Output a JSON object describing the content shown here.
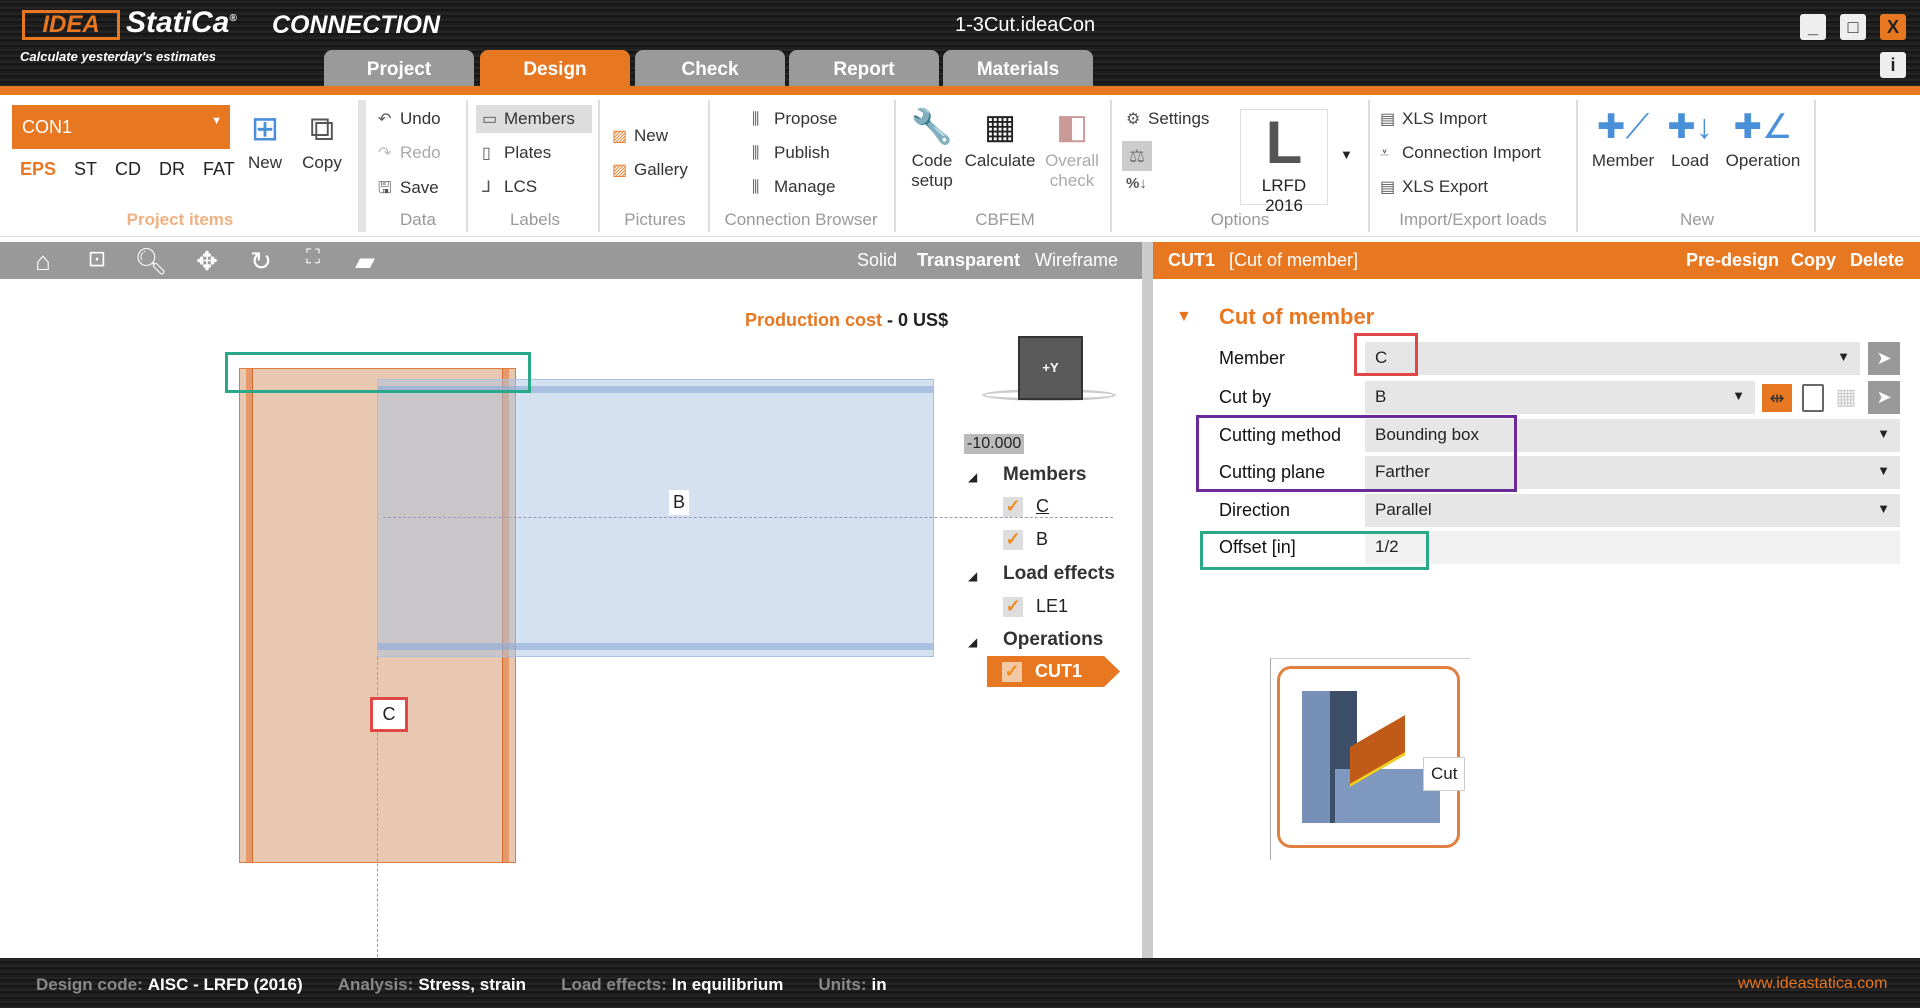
{
  "app": {
    "logo": "IDEA StatiCa",
    "product": "CONNECTION",
    "slogan": "Calculate yesterday's estimates",
    "file_title": "1-3Cut.ideaCon",
    "minimize": "_",
    "maximize": "□",
    "close": "X",
    "info": "i"
  },
  "tabs": [
    {
      "label": "Project"
    },
    {
      "label": "Design",
      "active": true
    },
    {
      "label": "Check"
    },
    {
      "label": "Report"
    },
    {
      "label": "Materials"
    }
  ],
  "ribbon": {
    "project_items": {
      "selected": "CON1",
      "codes": [
        "EPS",
        "ST",
        "CD",
        "DR",
        "FAT"
      ],
      "new": "New",
      "copy": "Copy",
      "label": "Project items"
    },
    "data": {
      "undo": "Undo",
      "redo": "Redo",
      "save": "Save",
      "label": "Data"
    },
    "labels": {
      "members": "Members",
      "plates": "Plates",
      "lcs": "LCS",
      "label": "Labels"
    },
    "pictures": {
      "new": "New",
      "gallery": "Gallery",
      "label": "Pictures"
    },
    "browser": {
      "propose": "Propose",
      "publish": "Publish",
      "manage": "Manage",
      "label": "Connection Browser"
    },
    "cbfem": {
      "code_setup_1": "Code",
      "code_setup_2": "setup",
      "calculate": "Calculate",
      "overall_1": "Overall",
      "overall_2": "check",
      "label": "CBFEM"
    },
    "options": {
      "settings": "Settings",
      "code_letter": "L",
      "code": "LRFD 2016",
      "label": "Options"
    },
    "import_export": {
      "xls_import": "XLS Import",
      "connection_import": "Connection Import",
      "xls_export": "XLS Export",
      "label": "Import/Export loads"
    },
    "new": {
      "member": "Member",
      "load": "Load",
      "operation": "Operation",
      "label": "New"
    }
  },
  "viewport": {
    "modes": [
      "Solid",
      "Transparent",
      "Wireframe"
    ],
    "active_mode": "Transparent",
    "cost_label": "Production cost",
    "cost_sep": "-",
    "cost_value": "0 US$",
    "view_cube": "+Y",
    "coord": "-10.000",
    "member_b": "B",
    "member_c": "C",
    "tree": {
      "members": "Members",
      "member_items": [
        "C",
        "B"
      ],
      "load_effects": "Load effects",
      "load_items": [
        "LE1"
      ],
      "operations": "Operations",
      "operation_items": [
        "CUT1"
      ]
    }
  },
  "panel": {
    "id": "CUT1",
    "type": "[Cut of member]",
    "pre_design": "Pre-design",
    "copy": "Copy",
    "delete": "Delete",
    "section": "Cut of member",
    "rows": [
      {
        "label": "Member",
        "value": "C"
      },
      {
        "label": "Cut by",
        "value": "B"
      },
      {
        "label": "Cutting method",
        "value": "Bounding box"
      },
      {
        "label": "Cutting plane",
        "value": "Farther"
      },
      {
        "label": "Direction",
        "value": "Parallel"
      },
      {
        "label": "Offset [in]",
        "value": "1/2"
      }
    ],
    "thumb_label": "Cut"
  },
  "status": {
    "design_code_k": "Design code:",
    "design_code_v": "AISC - LRFD (2016)",
    "analysis_k": "Analysis:",
    "analysis_v": "Stress, strain",
    "load_k": "Load effects:",
    "load_v": "In equilibrium",
    "units_k": "Units:",
    "units_v": "in",
    "website": "www.ideastatica.com"
  },
  "colors": {
    "accent": "#e87722",
    "highlight_red": "#e04848",
    "highlight_purple": "#6a2a9a",
    "highlight_teal": "#2aa88a"
  }
}
